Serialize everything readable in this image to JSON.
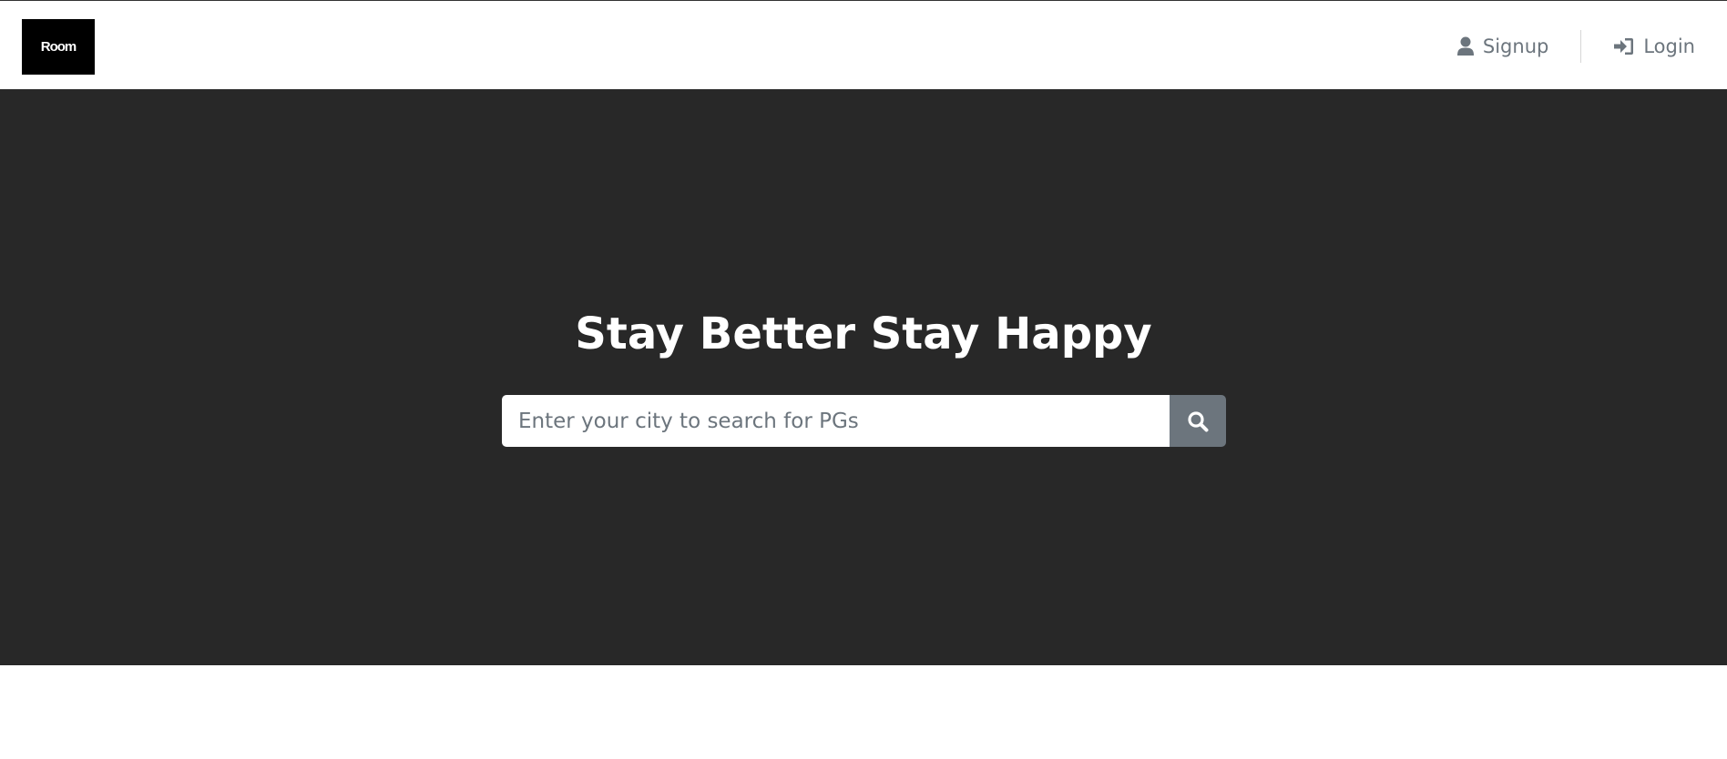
{
  "brand": {
    "logo_text": "Room"
  },
  "nav": {
    "signup_label": "Signup",
    "login_label": "Login"
  },
  "hero": {
    "title": "Stay Better Stay Happy",
    "search": {
      "placeholder": "Enter your city to search for PGs",
      "value": ""
    }
  },
  "icons": {
    "signup": "user-icon",
    "login": "sign-in-icon",
    "search": "search-icon"
  },
  "colors": {
    "hero_background": "#282828",
    "nav_link": "#6c757d",
    "search_button": "#6c757d",
    "logo_background": "#000000"
  }
}
